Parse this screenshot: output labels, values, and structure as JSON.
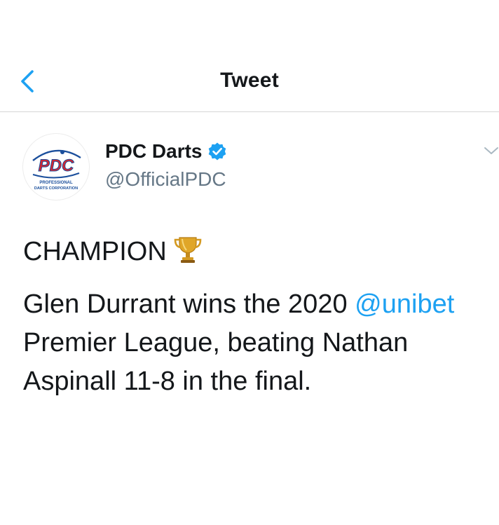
{
  "header": {
    "title": "Tweet"
  },
  "tweet": {
    "author": {
      "display_name": "PDC Darts",
      "handle": "@OfficialPDC",
      "verified": true,
      "avatar_logo_text": "PDC",
      "avatar_subtext_1": "PROFESSIONAL",
      "avatar_subtext_2": "DARTS CORPORATION"
    },
    "headline": "CHAMPION",
    "line2_before_mention": "Glen Durrant wins the 2020 ",
    "mention": "@unibet",
    "line3": "Premier League, beating Nathan",
    "line4": "Aspinall 11-8 in the final."
  },
  "colors": {
    "accent": "#1da1f2",
    "text": "#14171a",
    "secondary": "#657786",
    "divider": "#d6d6d6",
    "pdc_blue": "#1b4f9c",
    "pdc_red": "#d8262e"
  },
  "icons": {
    "back": "chevron-left-icon",
    "verified": "verified-badge-icon",
    "more": "chevron-down-icon",
    "emoji": "trophy-icon"
  }
}
